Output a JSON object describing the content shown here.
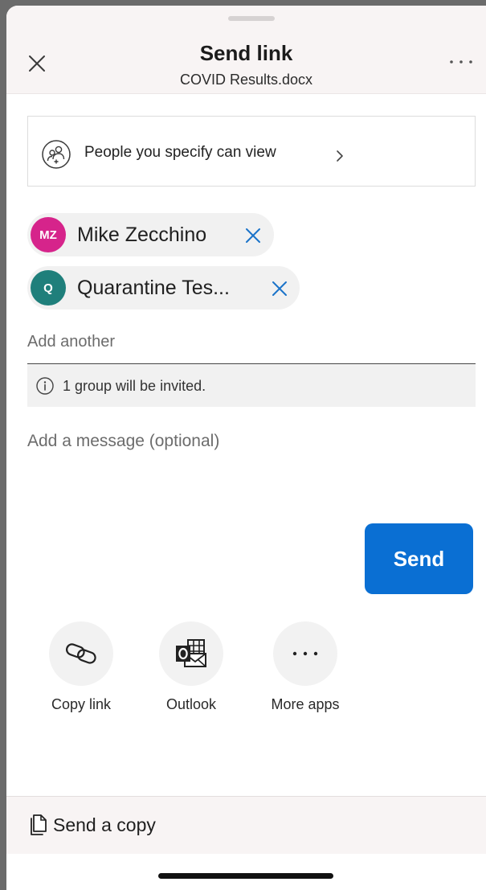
{
  "header": {
    "title": "Send link",
    "subtitle": "COVID Results.docx"
  },
  "permissions": {
    "label": "People you specify can view"
  },
  "recipients": [
    {
      "initials": "MZ",
      "name": "Mike Zecchino",
      "avatar_color": "#d6248b"
    },
    {
      "initials": "Q",
      "name": "Quarantine Tes...",
      "avatar_color": "#1f7f7b"
    }
  ],
  "add_recipient": {
    "placeholder": "Add another"
  },
  "info": {
    "text": "1 group will be invited."
  },
  "message": {
    "placeholder": "Add a message (optional)"
  },
  "send_button": {
    "label": "Send"
  },
  "share_options": [
    {
      "label": "Copy link",
      "icon": "link-icon"
    },
    {
      "label": "Outlook",
      "icon": "outlook-icon"
    },
    {
      "label": "More apps",
      "icon": "ellipsis-icon"
    }
  ],
  "footer": {
    "label": "Send a copy"
  },
  "colors": {
    "accent": "#0a6fd3",
    "chip_remove": "#1a73c9"
  }
}
